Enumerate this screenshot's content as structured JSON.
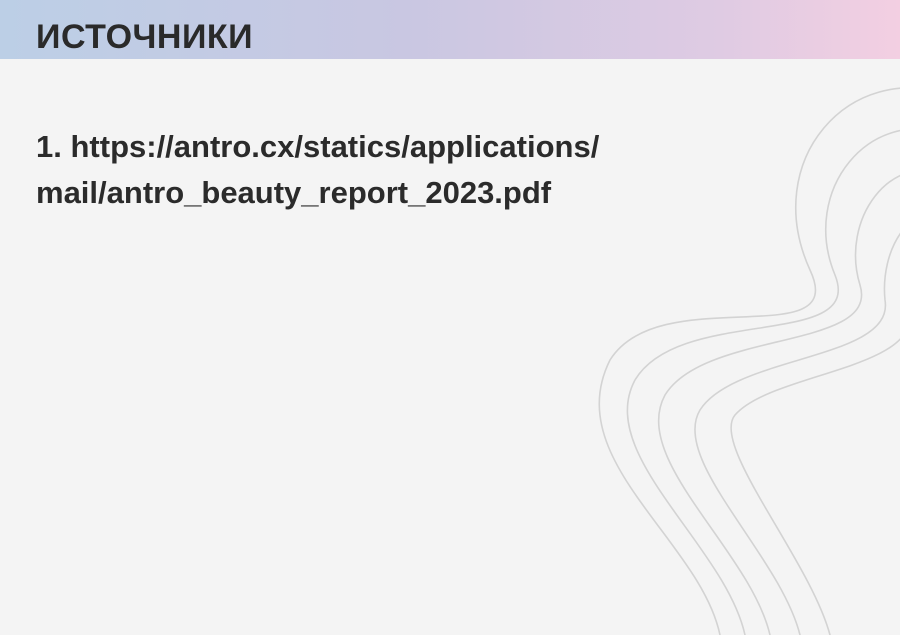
{
  "header": {
    "title": "ИСТОЧНИКИ"
  },
  "sources": [
    {
      "number": "1.",
      "line1": "https://antro.cx/statics/applications/",
      "line2": "mail/antro_beauty_report_2023.pdf"
    }
  ],
  "colors": {
    "background": "#f4f4f4",
    "header_gradient_start": "#bccfe6",
    "header_gradient_end": "#f3cfe2",
    "text": "#2b2b2b",
    "decoration_line": "#d3d3d3"
  }
}
